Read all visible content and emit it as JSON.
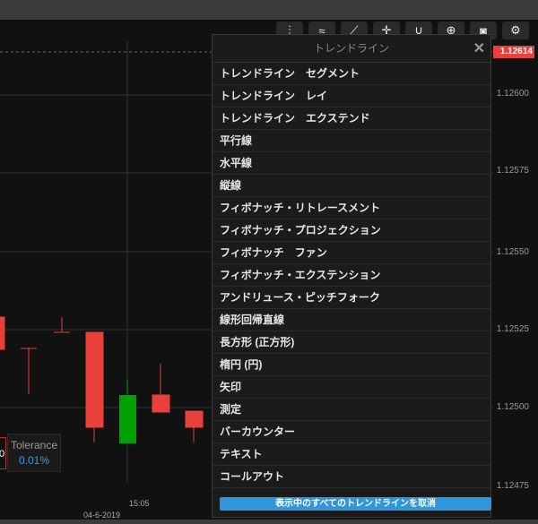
{
  "toolbar": {
    "icons": [
      "indicators-icon",
      "chart-type-icon",
      "trendline-icon",
      "crosshair-icon",
      "curve-icon",
      "zoom-in-icon",
      "camera-icon",
      "gear-icon"
    ]
  },
  "axis": {
    "prices": [
      "1.12600",
      "1.12575",
      "1.12550",
      "1.12525",
      "1.12500",
      "1.12475"
    ],
    "current_price": "1.12614",
    "time": "15:05",
    "date": "04-6-2019"
  },
  "tolerance": {
    "label": "Tolerance",
    "value": "0.01%",
    "partial": "0"
  },
  "panel": {
    "title": "トレンドライン",
    "close": "✕",
    "items": [
      "トレンドライン　セグメント",
      "トレンドライン　レイ",
      "トレンドライン　エクステンド",
      "平行線",
      "水平線",
      "縦線",
      "フィボナッチ・リトレースメント",
      "フィボナッチ・プロジェクション",
      "フィボナッチ　ファン",
      "フィボナッチ・エクステンション",
      "アンドリュース・ピッチフォーク",
      "線形回帰直線",
      "長方形 (正方形)",
      "楕円 (円)",
      "矢印",
      "測定",
      "バーカウンター",
      "テキスト",
      "コールアウト"
    ],
    "cancel_button": "表示中のすべてのトレンドラインを取消"
  },
  "colors": {
    "up": "#00a000",
    "down": "#e8403a",
    "accent": "#2f96dc"
  }
}
